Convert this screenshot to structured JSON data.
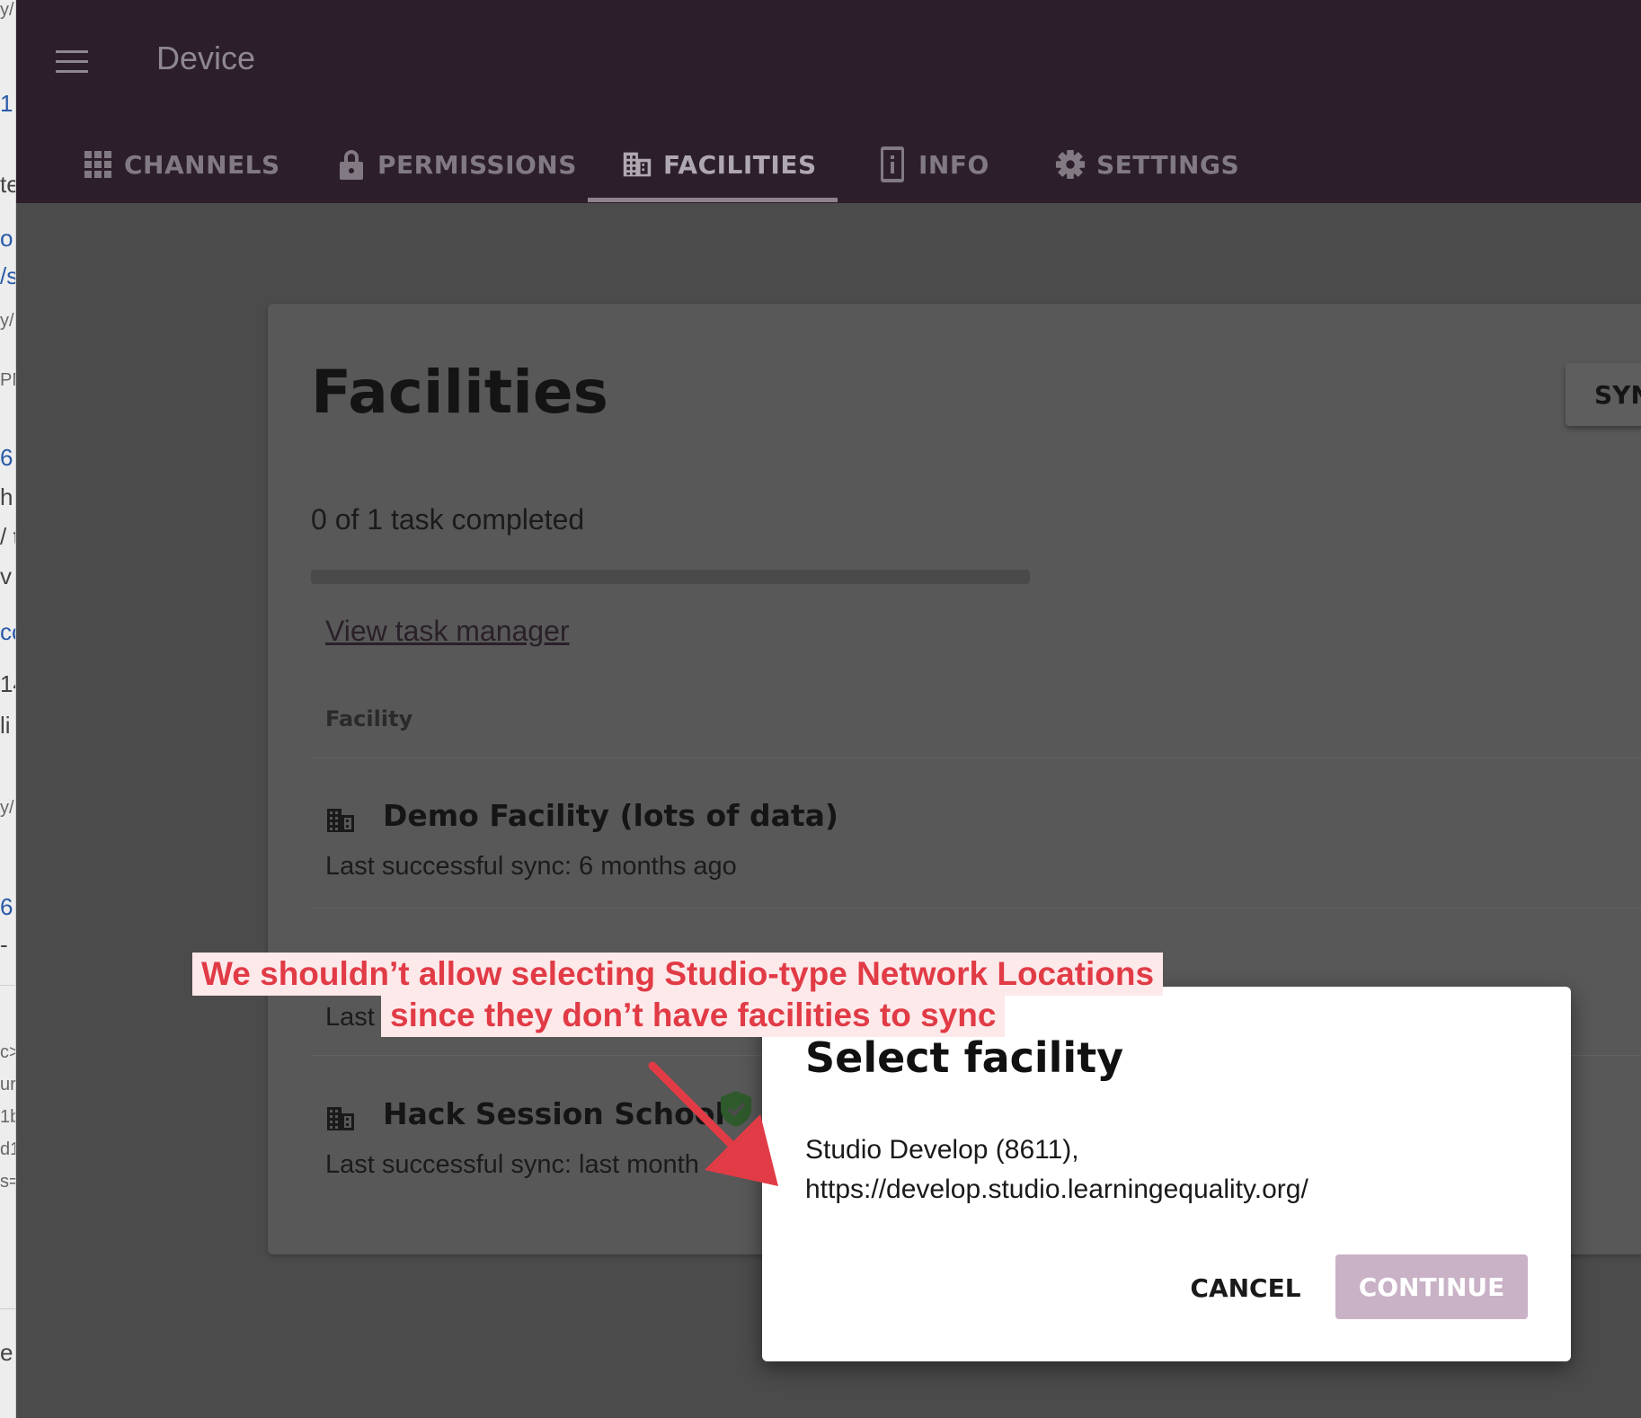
{
  "left_strip": {
    "fragments": [
      "y/",
      "1",
      "te",
      "o",
      "/s",
      "y/",
      "PM",
      "6",
      "h",
      "/ t",
      "v",
      "co",
      "14",
      "li",
      "y/",
      "6",
      "-",
      "c>",
      "ur",
      "1b",
      "d1",
      "s=",
      "e"
    ]
  },
  "app_bar": {
    "title": "Device",
    "tabs": [
      {
        "label": "CHANNELS",
        "icon": "grid-icon"
      },
      {
        "label": "PERMISSIONS",
        "icon": "lock-icon"
      },
      {
        "label": "FACILITIES",
        "icon": "building-icon"
      },
      {
        "label": "INFO",
        "icon": "info-icon"
      },
      {
        "label": "SETTINGS",
        "icon": "gear-icon"
      }
    ]
  },
  "page": {
    "title": "Facilities",
    "sync_label": "SYNC",
    "task_status": "0 of 1 task completed",
    "progress_fraction": 0,
    "task_link": "View task manager",
    "column_header": "Facility",
    "facilities": [
      {
        "name": "Demo Facility (lots of data)",
        "sync": "Last successful sync: 6 months ago"
      },
      {
        "name": "",
        "sync": "Last"
      },
      {
        "name": "Hack Session School",
        "sync": "Last successful sync: last month"
      }
    ]
  },
  "dialog": {
    "title": "Select facility",
    "body_line1": "Studio Develop (8611),",
    "body_line2": "https://develop.studio.learningequality.org/",
    "cancel": "CANCEL",
    "continue": "CONTINUE"
  },
  "annotation": {
    "line1": "We shouldn’t allow selecting Studio-type Network Locations",
    "line2": "since they don’t have facilities to sync",
    "color": "#e13b46"
  },
  "colors": {
    "app_bar": "#2c1f2b",
    "continue_button": "#c9b1c6",
    "shield": "#2f5a2c"
  }
}
